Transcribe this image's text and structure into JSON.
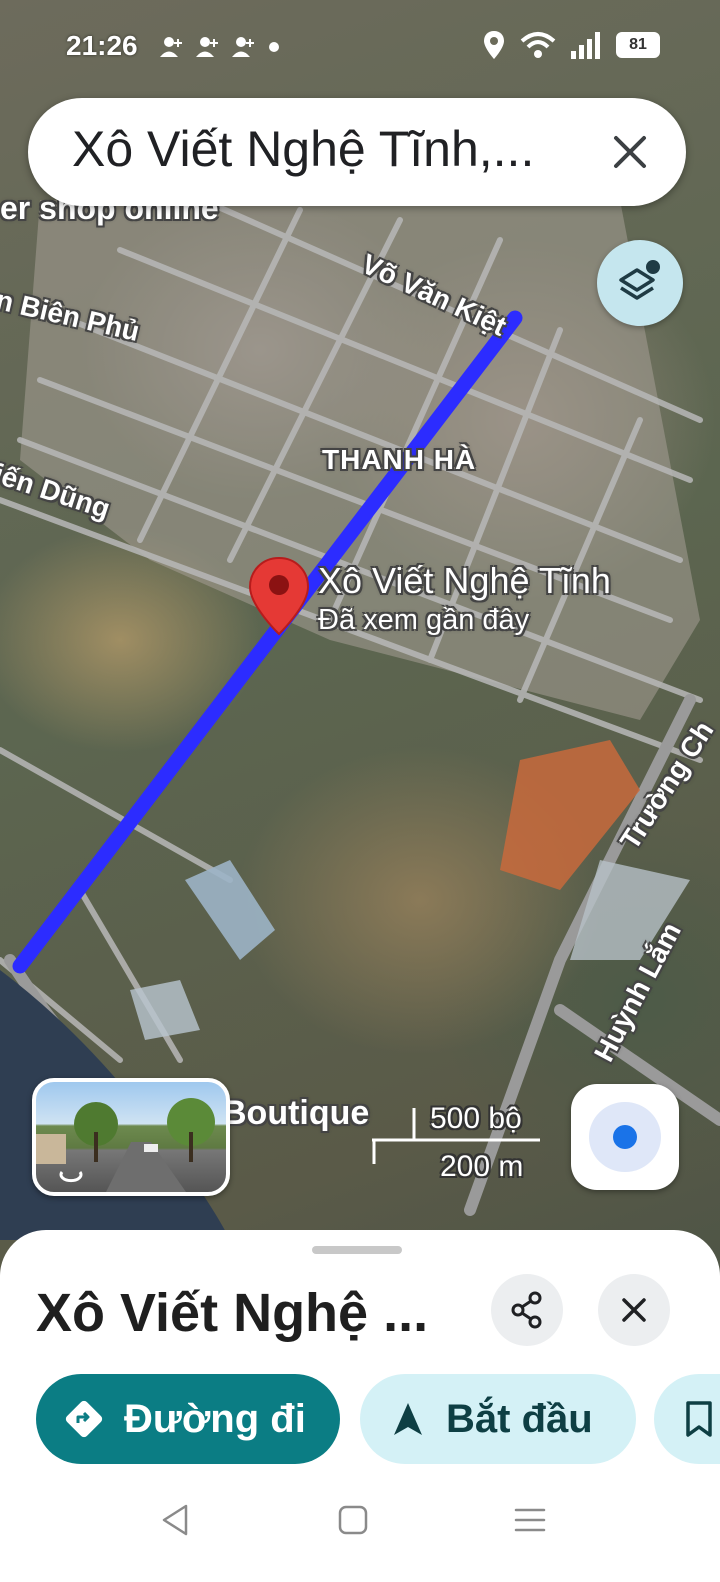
{
  "status_bar": {
    "time": "21:26",
    "battery": "81",
    "icons": [
      "person-add-icon",
      "person-add-icon",
      "person-add-icon",
      "dot-icon",
      "location-icon",
      "wifi-icon",
      "signal-icon",
      "battery-icon"
    ]
  },
  "search": {
    "query": "Xô Viết Nghệ Tĩnh,...",
    "clear_icon": "close-icon"
  },
  "map": {
    "route_color": "#1a3cff",
    "labels": {
      "shop": "er shop online",
      "street_vo_van_kiet": "Võ Văn Kiệt",
      "street_bien_phu": "n Biên Phủ",
      "area_thanh_ha": "THANH HÀ",
      "street_dung": "iến Dũng",
      "street_truong": "Trường Ch",
      "street_huynh_lam": "Huỳnh Lắm",
      "poi_boutique": "Boutique"
    },
    "pin": {
      "title": "Xô Viết Nghệ Tĩnh",
      "subtitle": "Đã xem gần đây",
      "color": "#e53935"
    },
    "scale": {
      "feet": "500 bộ",
      "meters": "200 m"
    }
  },
  "place_sheet": {
    "title": "Xô Viết Nghệ ...",
    "share_icon": "share-icon",
    "close_icon": "close-icon",
    "actions": [
      {
        "label": "Đường đi",
        "icon": "directions-icon"
      },
      {
        "label": "Bắt đầu",
        "icon": "navigation-arrow-icon"
      },
      {
        "label": "",
        "icon": "bookmark-icon"
      }
    ],
    "accent_color": "#0b7d84",
    "secondary_bg": "#d4f1f6"
  },
  "nav_bar": {
    "icons": [
      "back-icon",
      "home-icon",
      "recents-icon"
    ]
  }
}
